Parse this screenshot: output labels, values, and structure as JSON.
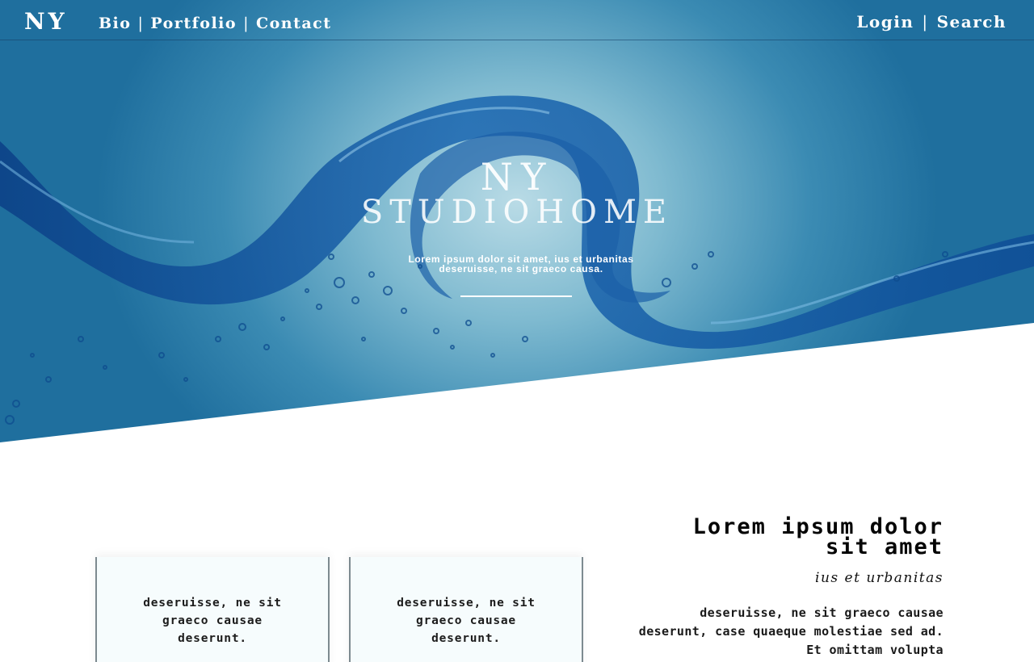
{
  "nav": {
    "logo": "NY",
    "links": [
      "Bio",
      "Portfolio",
      "Contact"
    ],
    "right_links": [
      "Login",
      "Search"
    ],
    "separator": "|"
  },
  "hero": {
    "title_line1": "NY",
    "title_line2": "STUDIOHOME",
    "subtitle": "Lorem ipsum dolor sit amet, ius et urbanitas deseruisse, ne sit graeco causa."
  },
  "cards": [
    {
      "text": "deseruisse, ne sit graeco causae deserunt."
    },
    {
      "text": "deseruisse, ne sit graeco causae deserunt."
    }
  ],
  "feature": {
    "title": "Lorem ipsum dolor sit amet",
    "subtitle": "ius et urbanitas",
    "body": "deseruisse, ne sit graeco causae deserunt, case quaeque molestiae sed ad. Et omittam volupta"
  },
  "colors": {
    "hero_blue": "#3b8bb3",
    "wave_dark": "#0d4a8a",
    "text_dark": "#050505"
  }
}
